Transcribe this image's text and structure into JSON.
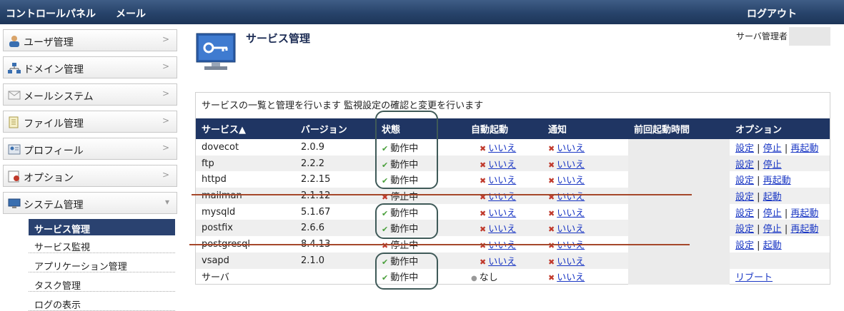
{
  "topbar": {
    "nav_items": [
      "コントロールパネル",
      "メール"
    ],
    "logout": "ログアウト"
  },
  "sidebar": {
    "items": [
      {
        "label": "ユーザ管理",
        "icon": "users-icon"
      },
      {
        "label": "ドメイン管理",
        "icon": "network-icon"
      },
      {
        "label": "メールシステム",
        "icon": "envelope-icon"
      },
      {
        "label": "ファイル管理",
        "icon": "files-icon"
      },
      {
        "label": "プロフィール",
        "icon": "profile-icon"
      },
      {
        "label": "オプション",
        "icon": "options-icon"
      },
      {
        "label": "システム管理",
        "icon": "system-icon",
        "expanded": true
      }
    ],
    "subitems": [
      "サービス管理",
      "サービス監視",
      "アプリケーション管理",
      "タスク管理",
      "ログの表示"
    ],
    "active_subitem": "サービス管理"
  },
  "header": {
    "title": "サービス管理",
    "admin_label": "サーバ管理者"
  },
  "panel": {
    "description": "サービスの一覧と管理を行います 監視設定の確認と変更を行います",
    "columns": [
      "サービス▲",
      "バージョン",
      "状態",
      "自動起動",
      "通知",
      "前回起動時間",
      "オプション"
    ],
    "rows": [
      {
        "service": "dovecot",
        "version": "2.0.9",
        "status": "動作中",
        "running": true,
        "autostart": "いいえ",
        "notify": "いいえ",
        "options": [
          "設定",
          "停止",
          "再起動"
        ]
      },
      {
        "service": "ftp",
        "version": "2.2.2",
        "status": "動作中",
        "running": true,
        "autostart": "いいえ",
        "notify": "いいえ",
        "options": [
          "設定",
          "停止"
        ]
      },
      {
        "service": "httpd",
        "version": "2.2.15",
        "status": "動作中",
        "running": true,
        "autostart": "いいえ",
        "notify": "いいえ",
        "options": [
          "設定",
          "再起動"
        ]
      },
      {
        "service": "mailman",
        "version": "2.1.12",
        "status": "停止中",
        "running": false,
        "autostart": "いいえ",
        "notify": "いいえ",
        "options": [
          "設定",
          "起動"
        ]
      },
      {
        "service": "mysqld",
        "version": "5.1.67",
        "status": "動作中",
        "running": true,
        "autostart": "いいえ",
        "notify": "いいえ",
        "options": [
          "設定",
          "停止",
          "再起動"
        ]
      },
      {
        "service": "postfix",
        "version": "2.6.6",
        "status": "動作中",
        "running": true,
        "autostart": "いいえ",
        "notify": "いいえ",
        "options": [
          "設定",
          "停止",
          "再起動"
        ]
      },
      {
        "service": "postgresql",
        "version": "8.4.13",
        "status": "停止中",
        "running": false,
        "autostart": "いいえ",
        "notify": "いいえ",
        "options": [
          "設定",
          "起動"
        ]
      },
      {
        "service": "vsapd",
        "version": "2.1.0",
        "status": "動作中",
        "running": true,
        "autostart": "いいえ",
        "notify": "いいえ",
        "options": []
      },
      {
        "service": "サーバ",
        "version": "",
        "status": "動作中",
        "running": true,
        "autostart": "なし",
        "autostart_none": true,
        "notify": "いいえ",
        "options": [
          "リブート"
        ]
      }
    ]
  }
}
